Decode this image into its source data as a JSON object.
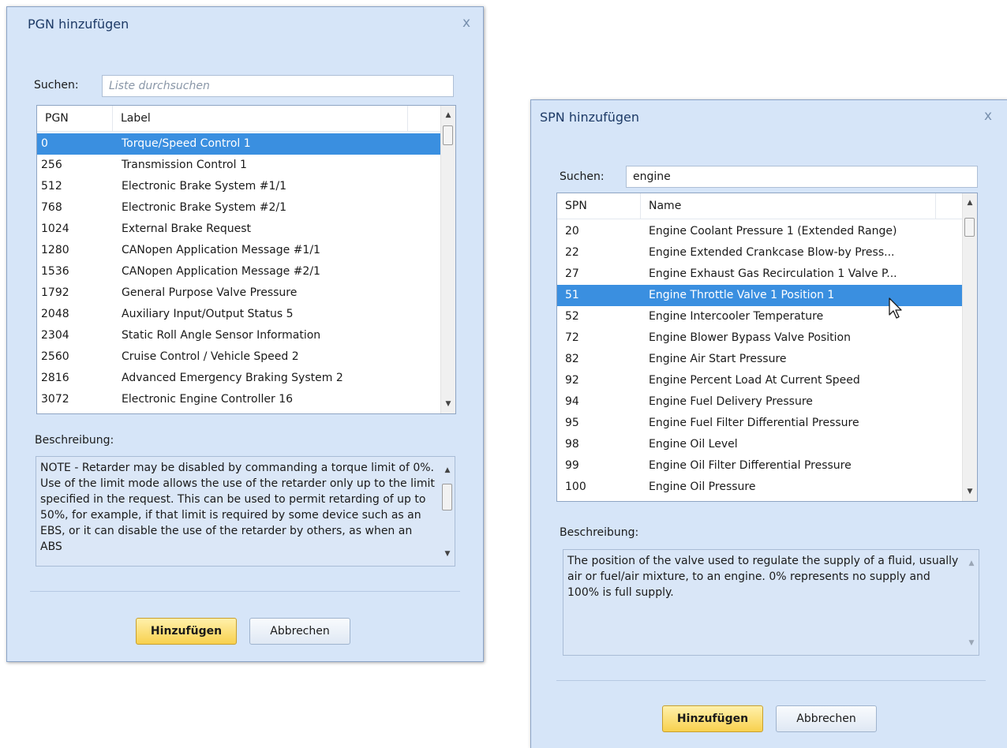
{
  "pgn_dialog": {
    "title": "PGN hinzufügen",
    "close_label": "x",
    "search_label": "Suchen:",
    "search_value": "",
    "search_placeholder": "Liste durchsuchen",
    "columns": [
      "PGN",
      "Label"
    ],
    "rows": [
      {
        "id": "0",
        "label": "Torque/Speed Control 1",
        "selected": true
      },
      {
        "id": "256",
        "label": "Transmission Control 1"
      },
      {
        "id": "512",
        "label": "Electronic Brake System #1/1"
      },
      {
        "id": "768",
        "label": "Electronic Brake System #2/1"
      },
      {
        "id": "1024",
        "label": "External Brake Request"
      },
      {
        "id": "1280",
        "label": "CANopen Application Message #1/1"
      },
      {
        "id": "1536",
        "label": "CANopen Application Message #2/1"
      },
      {
        "id": "1792",
        "label": "General Purpose Valve Pressure"
      },
      {
        "id": "2048",
        "label": "Auxiliary Input/Output Status 5"
      },
      {
        "id": "2304",
        "label": "Static Roll Angle Sensor Information"
      },
      {
        "id": "2560",
        "label": "Cruise Control / Vehicle Speed 2"
      },
      {
        "id": "2816",
        "label": "Advanced Emergency Braking System 2"
      },
      {
        "id": "3072",
        "label": "Electronic Engine Controller 16"
      }
    ],
    "description_label": "Beschreibung:",
    "description": "NOTE - Retarder may be disabled by commanding a torque limit of 0%.  Use of the limit mode allows the use of the retarder only up to the limit specified in the request.  This can be used to permit retarding of up to 50%, for example, if that limit is required by some device such as an EBS, or it can disable the use of the retarder by others, as when an ABS",
    "add_button": "Hinzufügen",
    "cancel_button": "Abbrechen"
  },
  "spn_dialog": {
    "title": "SPN hinzufügen",
    "close_label": "x",
    "search_label": "Suchen:",
    "search_value": "engine",
    "columns": [
      "SPN",
      "Name"
    ],
    "rows": [
      {
        "id": "20",
        "label": "Engine Coolant Pressure 1 (Extended Range)"
      },
      {
        "id": "22",
        "label": "Engine Extended Crankcase Blow-by Press..."
      },
      {
        "id": "27",
        "label": "Engine Exhaust Gas Recirculation 1 Valve P..."
      },
      {
        "id": "51",
        "label": "Engine Throttle Valve 1 Position 1",
        "selected": true
      },
      {
        "id": "52",
        "label": "Engine Intercooler Temperature"
      },
      {
        "id": "72",
        "label": "Engine Blower Bypass Valve Position"
      },
      {
        "id": "82",
        "label": "Engine Air Start Pressure"
      },
      {
        "id": "92",
        "label": "Engine Percent Load At Current Speed"
      },
      {
        "id": "94",
        "label": "Engine Fuel Delivery Pressure"
      },
      {
        "id": "95",
        "label": "Engine Fuel Filter Differential Pressure"
      },
      {
        "id": "98",
        "label": "Engine Oil Level"
      },
      {
        "id": "99",
        "label": "Engine Oil Filter Differential Pressure"
      },
      {
        "id": "100",
        "label": "Engine Oil Pressure"
      }
    ],
    "description_label": "Beschreibung:",
    "description": "The position of the valve used to regulate the supply of a fluid, usually air or fuel/air mixture, to an engine.  0% represents no supply and 100% is full supply.",
    "add_button": "Hinzufügen",
    "cancel_button": "Abbrechen"
  },
  "icons": {
    "close": "close-icon",
    "scroll_up": "scroll-up-arrow-icon",
    "scroll_down": "scroll-down-arrow-icon",
    "cursor": "mouse-pointer-icon"
  },
  "colors": {
    "dialog_background": "#d6e5f8",
    "selection": "#3a8fe0",
    "primary_button": "#f8d14e"
  }
}
